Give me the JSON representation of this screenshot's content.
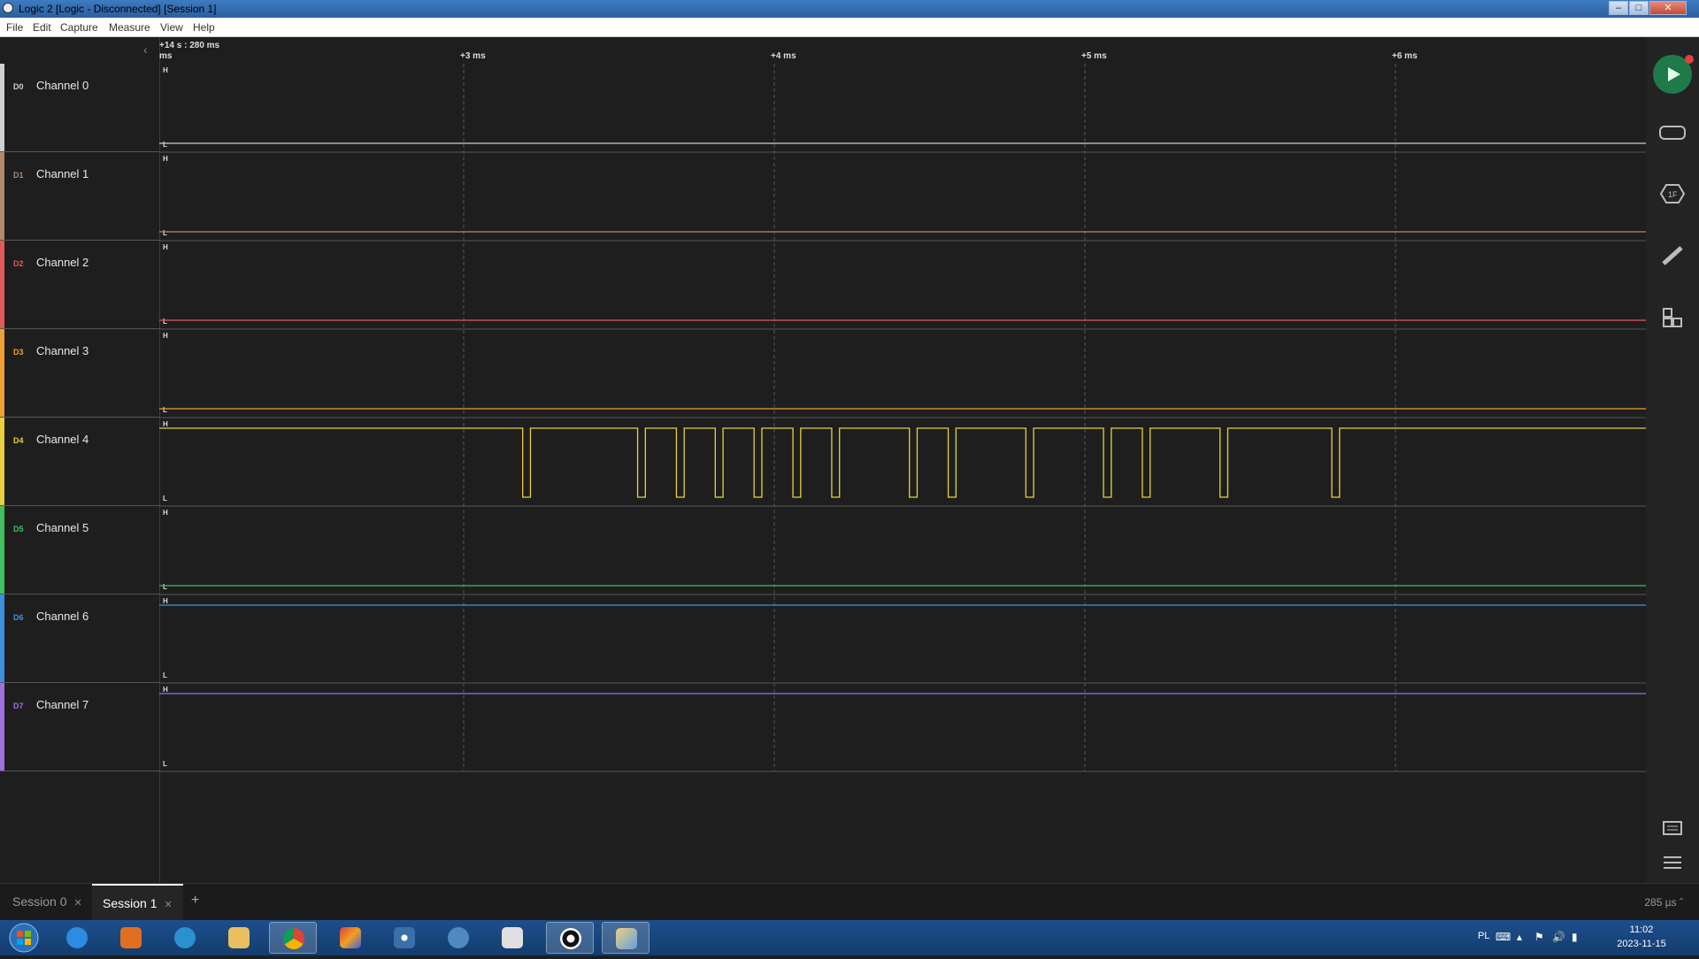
{
  "window": {
    "title": "Logic 2 [Logic - Disconnected] [Session 1]",
    "controls": [
      "minimize",
      "maximize",
      "close"
    ]
  },
  "menu": [
    "File",
    "Edit",
    "Capture",
    "Measure",
    "View",
    "Help"
  ],
  "timeline": {
    "cursor_label": "+14 s : 280 ms",
    "start_label": "ms",
    "ticks": [
      "+3 ms",
      "+4 ms",
      "+5 ms",
      "+6 ms"
    ]
  },
  "channels": [
    {
      "tag": "D0",
      "name": "Channel 0",
      "color": "#d0d0d0",
      "level": "low"
    },
    {
      "tag": "D1",
      "name": "Channel 1",
      "color": "#b08a6a",
      "level": "low"
    },
    {
      "tag": "D2",
      "name": "Channel 2",
      "color": "#e05a5a",
      "level": "low"
    },
    {
      "tag": "D3",
      "name": "Channel 3",
      "color": "#f0a030",
      "level": "low"
    },
    {
      "tag": "D4",
      "name": "Channel 4",
      "color": "#e8d040",
      "level": "pulses"
    },
    {
      "tag": "D5",
      "name": "Channel 5",
      "color": "#40c060",
      "level": "low"
    },
    {
      "tag": "D6",
      "name": "Channel 6",
      "color": "#4090e0",
      "level": "high"
    },
    {
      "tag": "D7",
      "name": "Channel 7",
      "color": "#a070e0",
      "level": "high"
    }
  ],
  "level_labels": {
    "high": "H",
    "low": "L"
  },
  "channel4_pulses_ms": [
    [
      3.19,
      3.215
    ],
    [
      3.56,
      3.585
    ],
    [
      3.685,
      3.71
    ],
    [
      3.81,
      3.835
    ],
    [
      3.935,
      3.96
    ],
    [
      4.06,
      4.085
    ],
    [
      4.185,
      4.21
    ],
    [
      4.435,
      4.46
    ],
    [
      4.56,
      4.585
    ],
    [
      4.81,
      4.835
    ],
    [
      5.06,
      5.085
    ],
    [
      5.185,
      5.21
    ],
    [
      5.435,
      5.46
    ],
    [
      5.795,
      5.82
    ]
  ],
  "right_toolbar": [
    "play-icon",
    "device-icon",
    "analyzer-icon",
    "measure-icon",
    "extensions-icon",
    "notes-icon",
    "menu-icon"
  ],
  "tabs": [
    {
      "label": "Session 0",
      "active": false
    },
    {
      "label": "Session 1",
      "active": true
    }
  ],
  "add_tab": "+",
  "zoom_label": "285 µs",
  "taskbar": {
    "apps": [
      "start-icon",
      "internet-explorer-icon",
      "media-player-icon",
      "browser-icon",
      "file-explorer-icon",
      "chrome-icon",
      "paint-app-icon",
      "dots-app-icon",
      "mu-editor-icon",
      "video-editor-icon",
      "logic-icon",
      "paint-icon"
    ],
    "active_apps": [
      "chrome-icon",
      "logic-icon",
      "paint-icon"
    ],
    "language": "PL",
    "time": "11:02",
    "date": "2023-11-15"
  }
}
